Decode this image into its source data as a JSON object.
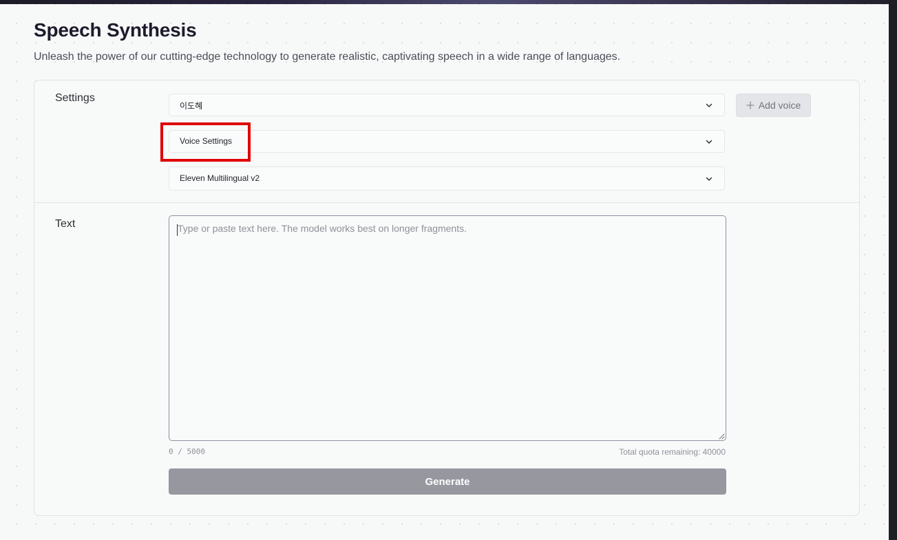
{
  "page": {
    "title": "Speech Synthesis",
    "subtitle": "Unleash the power of our cutting-edge technology to generate realistic, captivating speech in a wide range of languages."
  },
  "settings": {
    "label": "Settings",
    "voice_select": {
      "value": "이도혜",
      "icon": "chevron-down-icon"
    },
    "voice_settings_select": {
      "value": "Voice Settings",
      "icon": "chevron-down-icon"
    },
    "model_select": {
      "value": "Eleven Multilingual v2",
      "icon": "chevron-down-icon"
    },
    "add_voice": {
      "label": "Add voice",
      "icon": "plus-icon"
    }
  },
  "text_section": {
    "label": "Text",
    "textarea": {
      "value": "",
      "placeholder": "Type or paste text here. The model works best on longer fragments."
    },
    "char_count": "0 / 5000",
    "quota": "Total quota remaining: 40000"
  },
  "generate": {
    "label": "Generate"
  },
  "colors": {
    "highlight_box": "#e00000",
    "generate_button": "#97979f",
    "title_text": "#1d1b2b"
  }
}
